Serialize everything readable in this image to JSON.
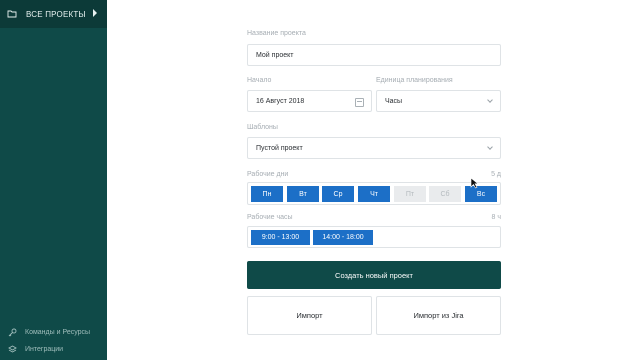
{
  "sidebar": {
    "title": "ВСЕ ПРОЕКТЫ",
    "bottom_items": [
      {
        "label": "Команды и Ресурсы",
        "icon": "key-icon"
      },
      {
        "label": "Интеграции",
        "icon": "layers-icon"
      }
    ]
  },
  "form": {
    "project_name_label": "Название проекта",
    "project_name_value": "Мой проект",
    "start_label": "Начало",
    "start_value": "16 Август 2018",
    "unit_label": "Единица планирования",
    "unit_value": "Часы",
    "template_label": "Шаблоны",
    "template_value": "Пустой проект",
    "workdays_label": "Рабочие дни",
    "workdays_count": "5 д",
    "days": [
      {
        "label": "Пн",
        "active": true
      },
      {
        "label": "Вт",
        "active": true
      },
      {
        "label": "Ср",
        "active": true
      },
      {
        "label": "Чт",
        "active": true
      },
      {
        "label": "Пт",
        "active": false
      },
      {
        "label": "Сб",
        "active": false
      },
      {
        "label": "Вс",
        "active": true
      }
    ],
    "workhours_label": "Рабочие часы",
    "workhours_count": "8 ч",
    "hours": [
      "9:00 - 13:00",
      "14:00 - 18:00"
    ],
    "create_button": "Создать новый проект",
    "import_button": "Импорт",
    "import_jira_button": "Импорт из Jira"
  },
  "colors": {
    "sidebar": "#0f4a48",
    "accent_blue": "#1c6fc7",
    "primary_button": "#0f4a48"
  }
}
